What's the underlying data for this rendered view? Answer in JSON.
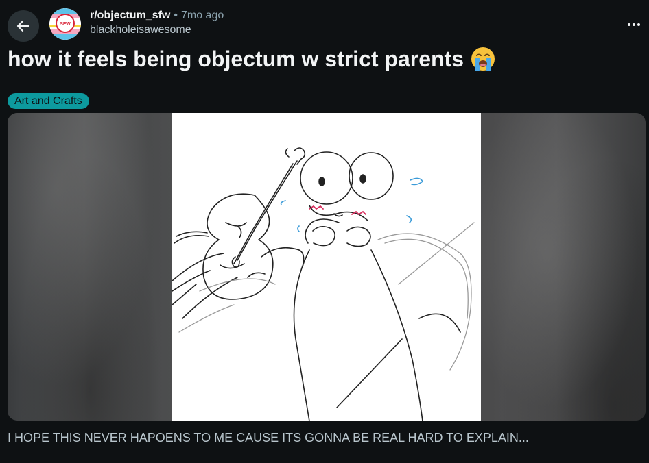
{
  "post": {
    "community": "r/objectum_sfw",
    "separator": "•",
    "time_ago": "7mo ago",
    "author": "blackholeisawesome",
    "avatar_text": "SFW",
    "title": "how it feels being objectum w strict parents",
    "title_emoji": "loudly-crying-face",
    "flair": "Art and Crafts",
    "body": "I HOPE THIS NEVER HAPOENS TO ME CAUSE ITS GONNA BE REAL HARD TO EXPLAIN..."
  },
  "icons": {
    "back": "arrow-left-icon",
    "more": "horizontal-ellipsis-icon"
  },
  "colors": {
    "background": "#0e1113",
    "flair_bg": "#0d9a9e",
    "text_primary": "#f2f4f5",
    "text_secondary": "#8ba2ad"
  }
}
